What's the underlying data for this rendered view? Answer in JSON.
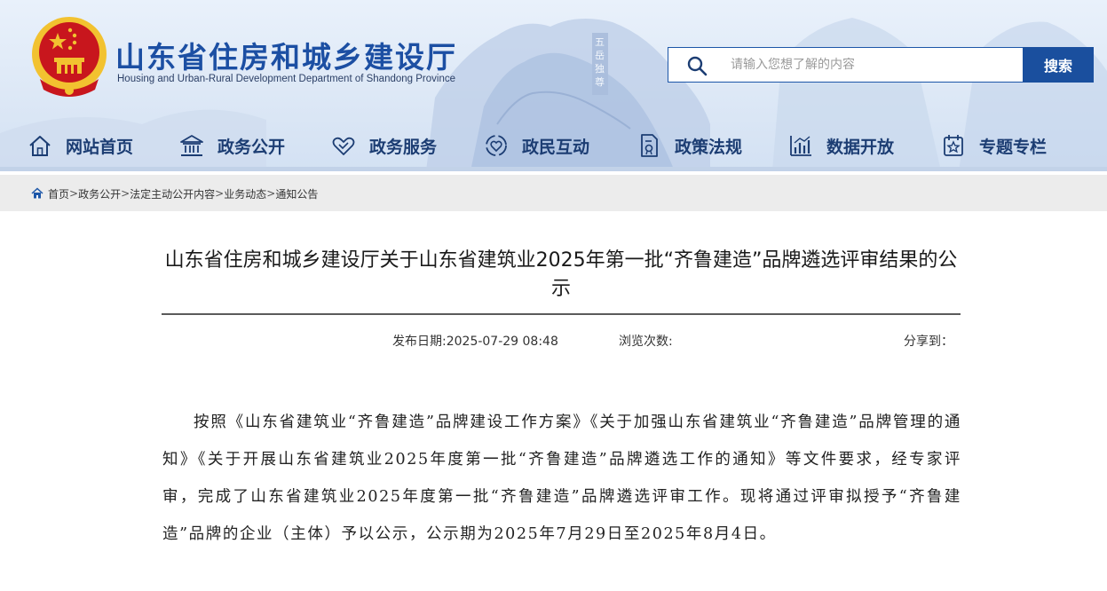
{
  "header": {
    "site_title": "山东省住房和城乡建设厅",
    "site_subtitle": "Housing and Urban-Rural Development Department of Shandong Province",
    "seal_text": "五岳独尊"
  },
  "search": {
    "placeholder": "请输入您想了解的内容",
    "button_label": "搜索"
  },
  "nav": {
    "items": [
      {
        "label": "网站首页",
        "icon": "home-icon"
      },
      {
        "label": "政务公开",
        "icon": "government-building-icon"
      },
      {
        "label": "政务服务",
        "icon": "handshake-icon"
      },
      {
        "label": "政民互动",
        "icon": "interaction-icon"
      },
      {
        "label": "政策法规",
        "icon": "policy-document-icon"
      },
      {
        "label": "数据开放",
        "icon": "data-chart-icon"
      },
      {
        "label": "专题专栏",
        "icon": "special-topic-icon"
      }
    ]
  },
  "breadcrumb": {
    "items": [
      "首页",
      "政务公开",
      "法定主动公开内容",
      "业务动态",
      "通知公告"
    ],
    "separator": ">"
  },
  "article": {
    "title": "山东省住房和城乡建设厅关于山东省建筑业2025年第一批“齐鲁建造”品牌遴选评审结果的公示",
    "publish_date": "发布日期:2025-07-29 08:48",
    "views_label": "浏览次数:",
    "share_label": "分享到：",
    "body": "按照《山东省建筑业“齐鲁建造”品牌建设工作方案》《关于加强山东省建筑业“齐鲁建造”品牌管理的通知》《关于开展山东省建筑业2025年度第一批“齐鲁建造”品牌遴选工作的通知》等文件要求，经专家评审，完成了山东省建筑业2025年度第一批“齐鲁建造”品牌遴选评审工作。现将通过评审拟授予“齐鲁建造”品牌的企业（主体）予以公示，公示期为2025年7月29日至2025年8月4日。"
  },
  "colors": {
    "brand_blue": "#1c4fa3",
    "nav_text": "#1c3d73",
    "search_button": "#1a4f9e",
    "emblem_red": "#c8161d",
    "emblem_gold": "#f2c230"
  }
}
